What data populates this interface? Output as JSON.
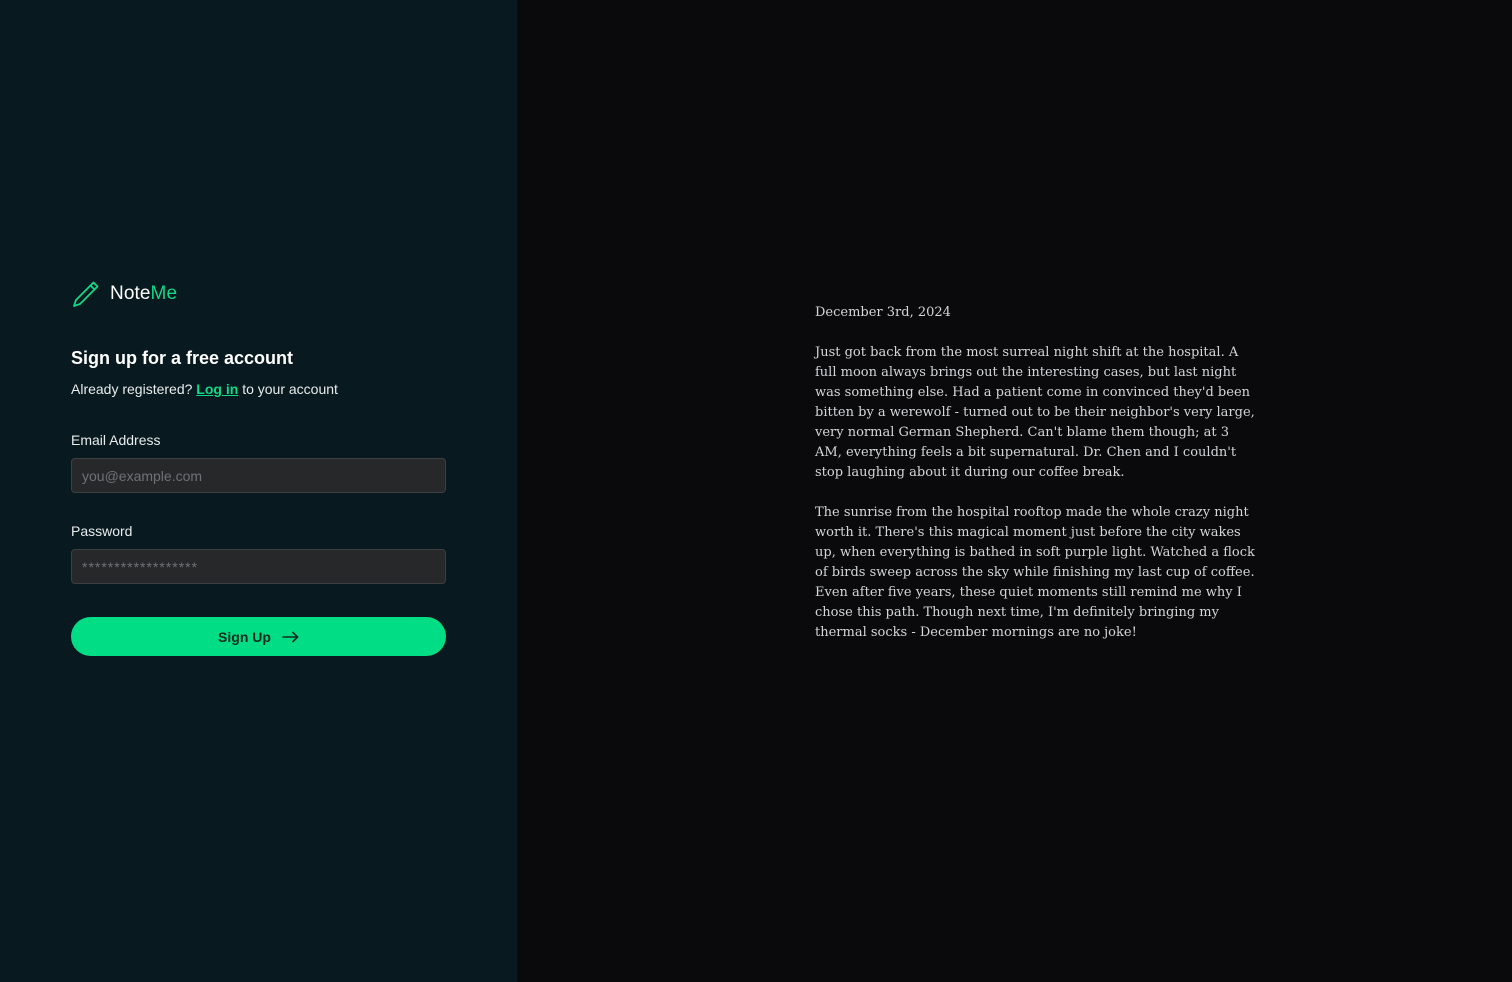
{
  "brand": {
    "name_part1": "Note",
    "name_part2": "Me",
    "icon": "pencil-icon",
    "accent_color": "#10d987"
  },
  "signup": {
    "heading": "Sign up for a free account",
    "subtitle_prefix": "Already registered?",
    "login_link": "Log in",
    "subtitle_suffix": "to your account"
  },
  "form": {
    "email_label": "Email Address",
    "email_placeholder": "you@example.com",
    "email_value": "",
    "password_label": "Password",
    "password_placeholder": "******************",
    "password_value": ""
  },
  "button": {
    "label": "Sign Up",
    "icon": "arrow-right-icon",
    "color": "#00dd84"
  },
  "journal": {
    "date": "December 3rd, 2024",
    "paragraphs": [
      "Just got back from the most surreal night shift at the hospital. A full moon always brings out the interesting cases, but last night was something else. Had a patient come in convinced they'd been bitten by a werewolf - turned out to be their neighbor's very large, very normal German Shepherd. Can't blame them though; at 3 AM, everything feels a bit supernatural. Dr. Chen and I couldn't stop laughing about it during our coffee break.",
      "The sunrise from the hospital rooftop made the whole crazy night worth it. There's this magical moment just before the city wakes up, when everything is bathed in soft purple light. Watched a flock of birds sweep across the sky while finishing my last cup of coffee. Even after five years, these quiet moments still remind me why I chose this path. Though next time, I'm definitely bringing my thermal socks - December mornings are no joke!"
    ]
  }
}
